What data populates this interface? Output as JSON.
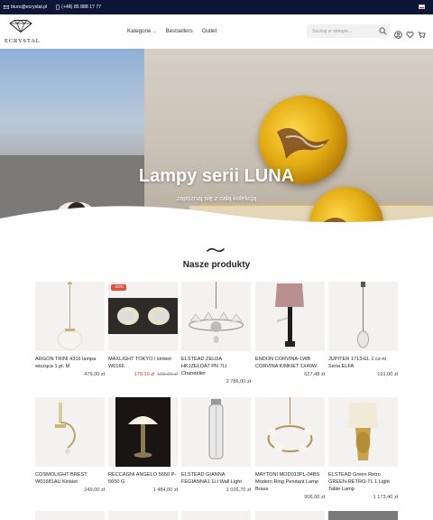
{
  "topbar": {
    "email": "biuro@ecrystal.pl",
    "phone": "(+48) 85 888 17 77"
  },
  "header": {
    "logo": "ECRYSTAL",
    "nav": [
      "Kategorie",
      "Bestsellers",
      "Outlet"
    ],
    "search_placeholder": "Szukaj w sklepie..."
  },
  "hero": {
    "title": "Lampy serii LUNA",
    "subtitle": "zapoznaj się z całą kolekcją"
  },
  "products": {
    "title": "Nasze produkty",
    "items": [
      {
        "name": "ARGON TRINI 4316 lampa wisząca 1 pł. M",
        "price": "479,00 zł"
      },
      {
        "name": "MAXLIGHT TOKYO I kinkiet W0166",
        "price": "179,10 zł",
        "old_price": "199,00 zł",
        "badge": "-10%"
      },
      {
        "name": "ELSTEAD ZELDA HKJZELDA7 PN 7Lt Chandelier",
        "price": "2 786,00 zł"
      },
      {
        "name": "ENDON CORVINA-1WB CORVINA KINKIET 1X40W",
        "price": "627,48 zł"
      },
      {
        "name": "JUPITER 1713-EL 1 cz-ni Seria ELFA",
        "price": "191,00 zł"
      },
      {
        "name": "COSMOLIGHT BREST W01681AU Kinkiet",
        "price": "249,00 zł"
      },
      {
        "name": "RECCAGNI ANGELO 5650 P-5650 G",
        "price": "1 484,00 zł"
      },
      {
        "name": "ELSTEAD GIANNA FEGIANNA1 1Lt Wall Light",
        "price": "1 026,70 zł"
      },
      {
        "name": "MAYTONI MOD013PL-04BS Modern Ring Pendant Lamp Brass",
        "price": "906,00 zł"
      },
      {
        "name": "ELSTEAD Green Retro GREEN-RETRO-TL 1 Light Table Lamp",
        "price": "1 173,40 zł"
      }
    ]
  },
  "colors": {
    "topbar": "#0c1738",
    "sale": "#c0392b",
    "badge": "#e74c3c"
  }
}
